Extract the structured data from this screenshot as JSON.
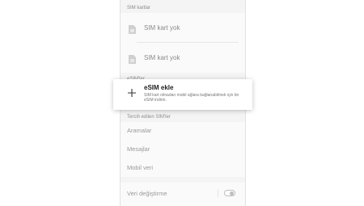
{
  "sim_cards": {
    "header": "SIM kartlar",
    "slots": [
      {
        "label": "SIM kart yok",
        "icon": "sim-card-icon"
      },
      {
        "label": "SIM kart yok",
        "icon": "sim-card-icon"
      }
    ]
  },
  "esim": {
    "header": "eSIM'ler",
    "popup": {
      "icon": "plus-icon",
      "title": "eSIM ekle",
      "description": "SIM kart olmadan mobil ağlara bağlanabilmek için bir eSIM indirin."
    }
  },
  "preferred": {
    "header": "Tercih edilen SIM'ler",
    "items": [
      "Aramalar",
      "Mesajlar",
      "Mobil veri"
    ]
  },
  "data_switch": {
    "label": "Veri değiştirme",
    "enabled": false
  }
}
